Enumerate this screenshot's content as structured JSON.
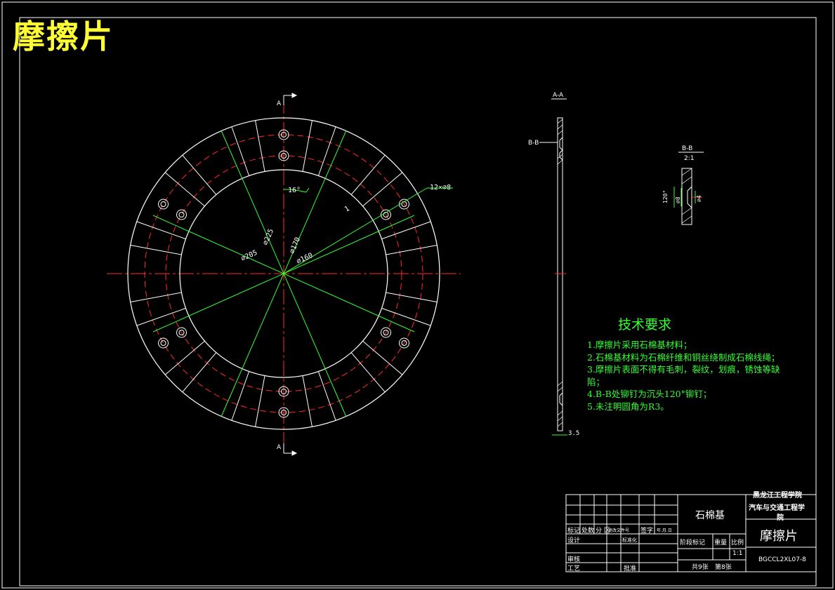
{
  "drawing": {
    "title": "摩擦片",
    "section_aa_label": "A-A",
    "section_bb_label": "B-B",
    "section_bb_scale": "2:1",
    "cut_label_a": "A",
    "cut_label_bb": "B-B",
    "dims": {
      "d205": "⌀205",
      "d225": "⌀225",
      "d170": "⌀170",
      "d160": "⌀160",
      "angle16": "16°",
      "holes": "12×⌀8",
      "thickness": "3.5",
      "bb_angle": "120°",
      "bb_d8": "⌀8",
      "bb_d4": "⌀4"
    },
    "colors": {
      "outline": "#ffffff",
      "center": "#ff2a2a",
      "dimension": "#33ff33",
      "text": "#ffff33"
    }
  },
  "tech_requirements": {
    "heading": "技术要求",
    "items": [
      "1.摩擦片采用石棉基材料；",
      "2.石棉基材料为石棉纤维和铜丝绕制成石棉线绳；",
      "3.摩擦片表面不得有毛刺，裂纹，划痕，锈蚀等缺",
      "陷；",
      "4.B-B处铆钉为沉头120°铆钉；",
      "5.未注明圆角为R3。"
    ]
  },
  "title_block": {
    "material": "石棉基",
    "school_line1": "黑龙江工程学院",
    "school_line2": "汽车与交通工程学",
    "school_line3": "院",
    "part_name": "摩擦片",
    "scale": "1:1",
    "drawing_no": "BGCCL2XL07-8",
    "sheets_total": "共9张",
    "sheet_no": "第8张",
    "labels": {
      "mark": "标记",
      "count": "处数",
      "zone": "分 区",
      "change_doc": "更改文件号",
      "sign": "签字",
      "date": "年.月.日",
      "design": "设计",
      "standard": "标准化",
      "stage_mark": "阶段标记",
      "weight": "重量",
      "ratio": "比例",
      "review": "审核",
      "process": "工艺",
      "approve": "批准"
    }
  }
}
